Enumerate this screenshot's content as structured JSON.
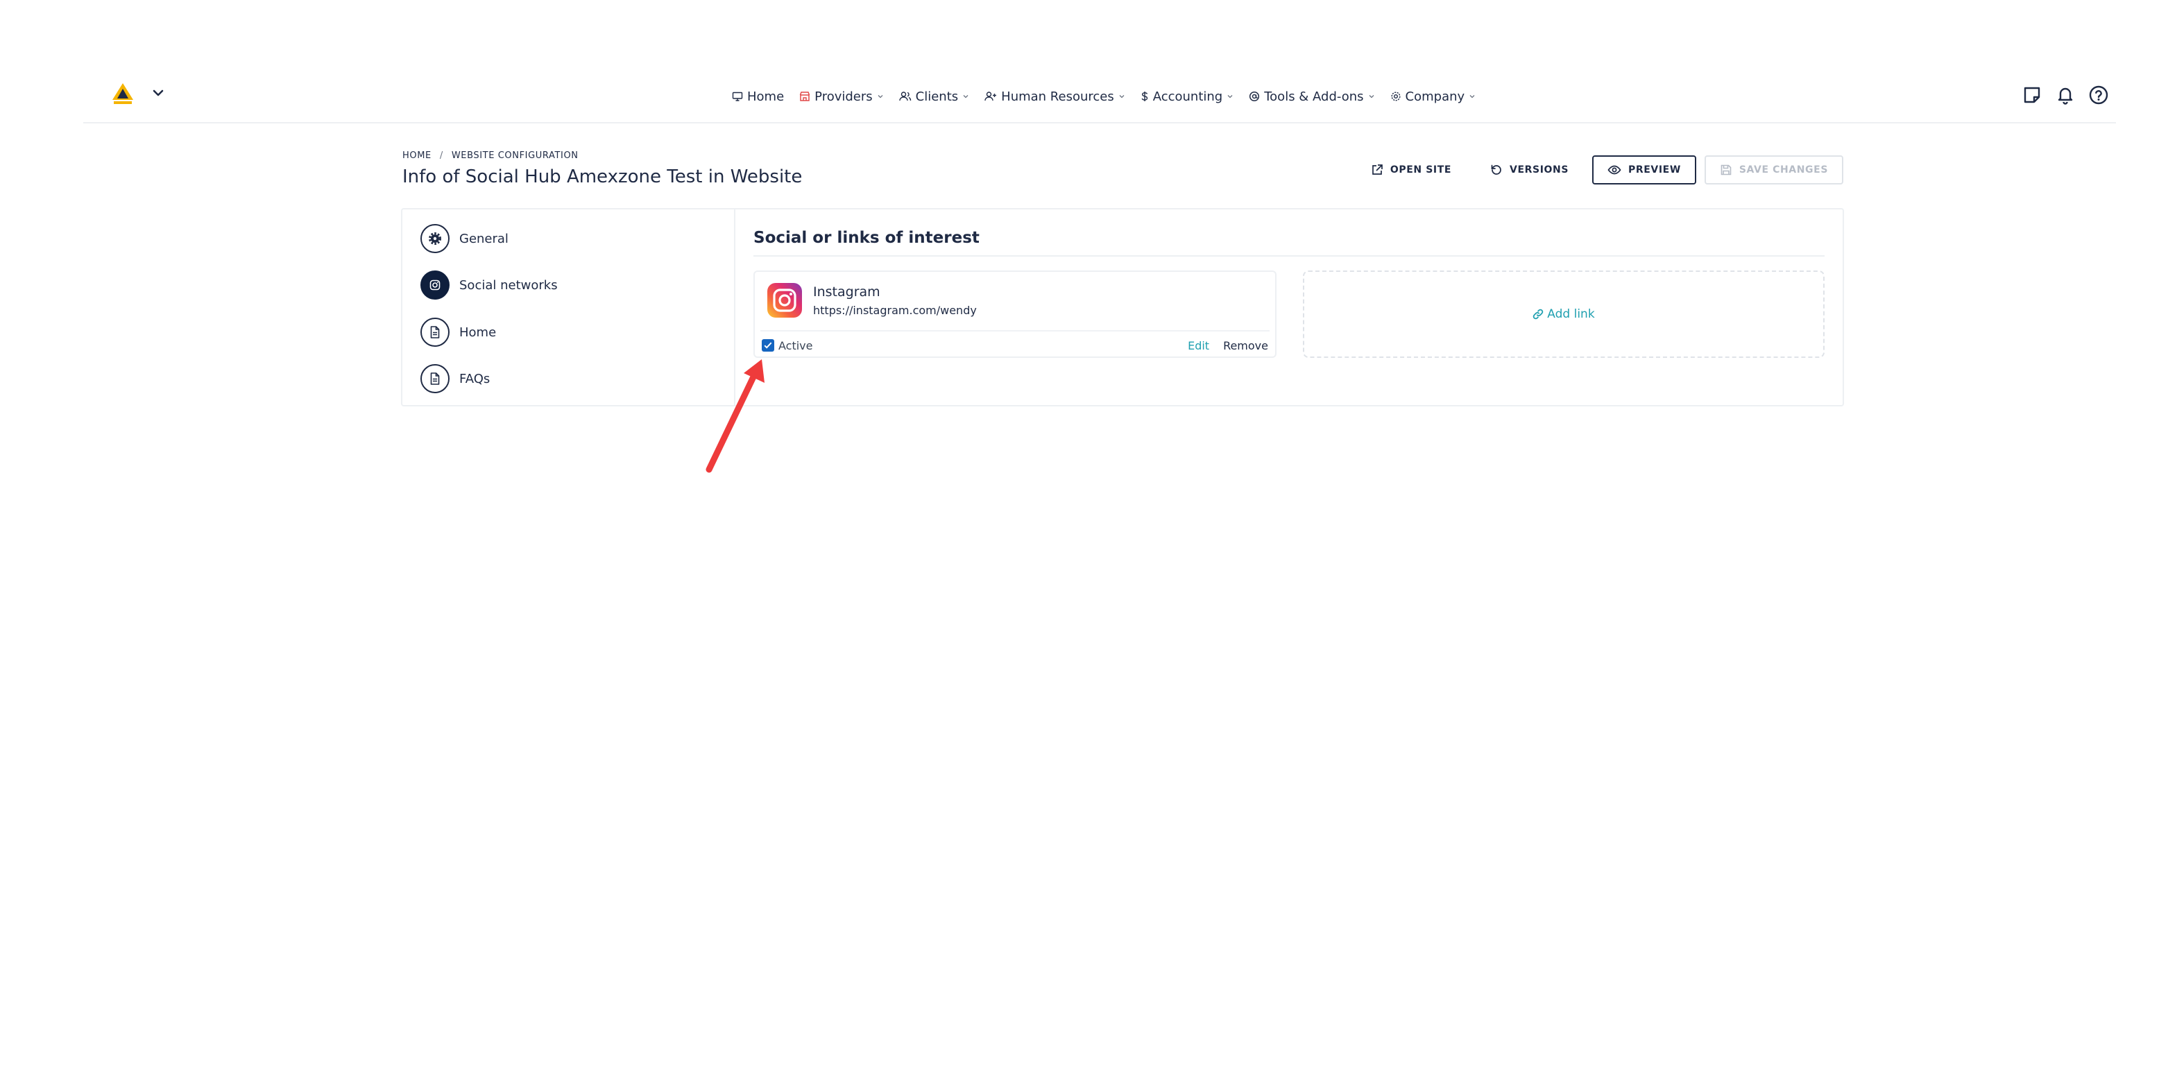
{
  "nav": {
    "items": [
      {
        "label": "Home",
        "icon": "monitor-icon"
      },
      {
        "label": "Providers",
        "icon": "store-icon"
      },
      {
        "label": "Clients",
        "icon": "users-icon"
      },
      {
        "label": "Human Resources",
        "icon": "user-plus-icon"
      },
      {
        "label": "Accounting",
        "icon": "dollar-icon"
      },
      {
        "label": "Tools & Add-ons",
        "icon": "at-icon"
      },
      {
        "label": "Company",
        "icon": "gear-icon"
      }
    ]
  },
  "breadcrumb": {
    "home": "HOME",
    "separator": "/",
    "current": "WEBSITE CONFIGURATION"
  },
  "page": {
    "title": "Info of Social Hub Amexzone Test in Website"
  },
  "actions": {
    "open_site": "OPEN SITE",
    "versions": "VERSIONS",
    "preview": "PREVIEW",
    "save": "SAVE CHANGES"
  },
  "sidebar": {
    "items": [
      {
        "label": "General",
        "icon": "gear-icon"
      },
      {
        "label": "Social networks",
        "icon": "instagram-icon",
        "active": true
      },
      {
        "label": "Home",
        "icon": "document-icon"
      },
      {
        "label": "FAQs",
        "icon": "document-icon"
      }
    ]
  },
  "section": {
    "title": "Social or links of interest"
  },
  "links": [
    {
      "name": "Instagram",
      "url": "https://instagram.com/wendy",
      "active_label": "Active",
      "active": true,
      "edit": "Edit",
      "remove": "Remove"
    }
  ],
  "add_link": {
    "label": "Add link"
  },
  "colors": {
    "primary": "#0f1f3d",
    "accent_link": "#20a0b0",
    "checkbox": "#1565c0",
    "annotation_arrow": "#ee3b3b"
  }
}
